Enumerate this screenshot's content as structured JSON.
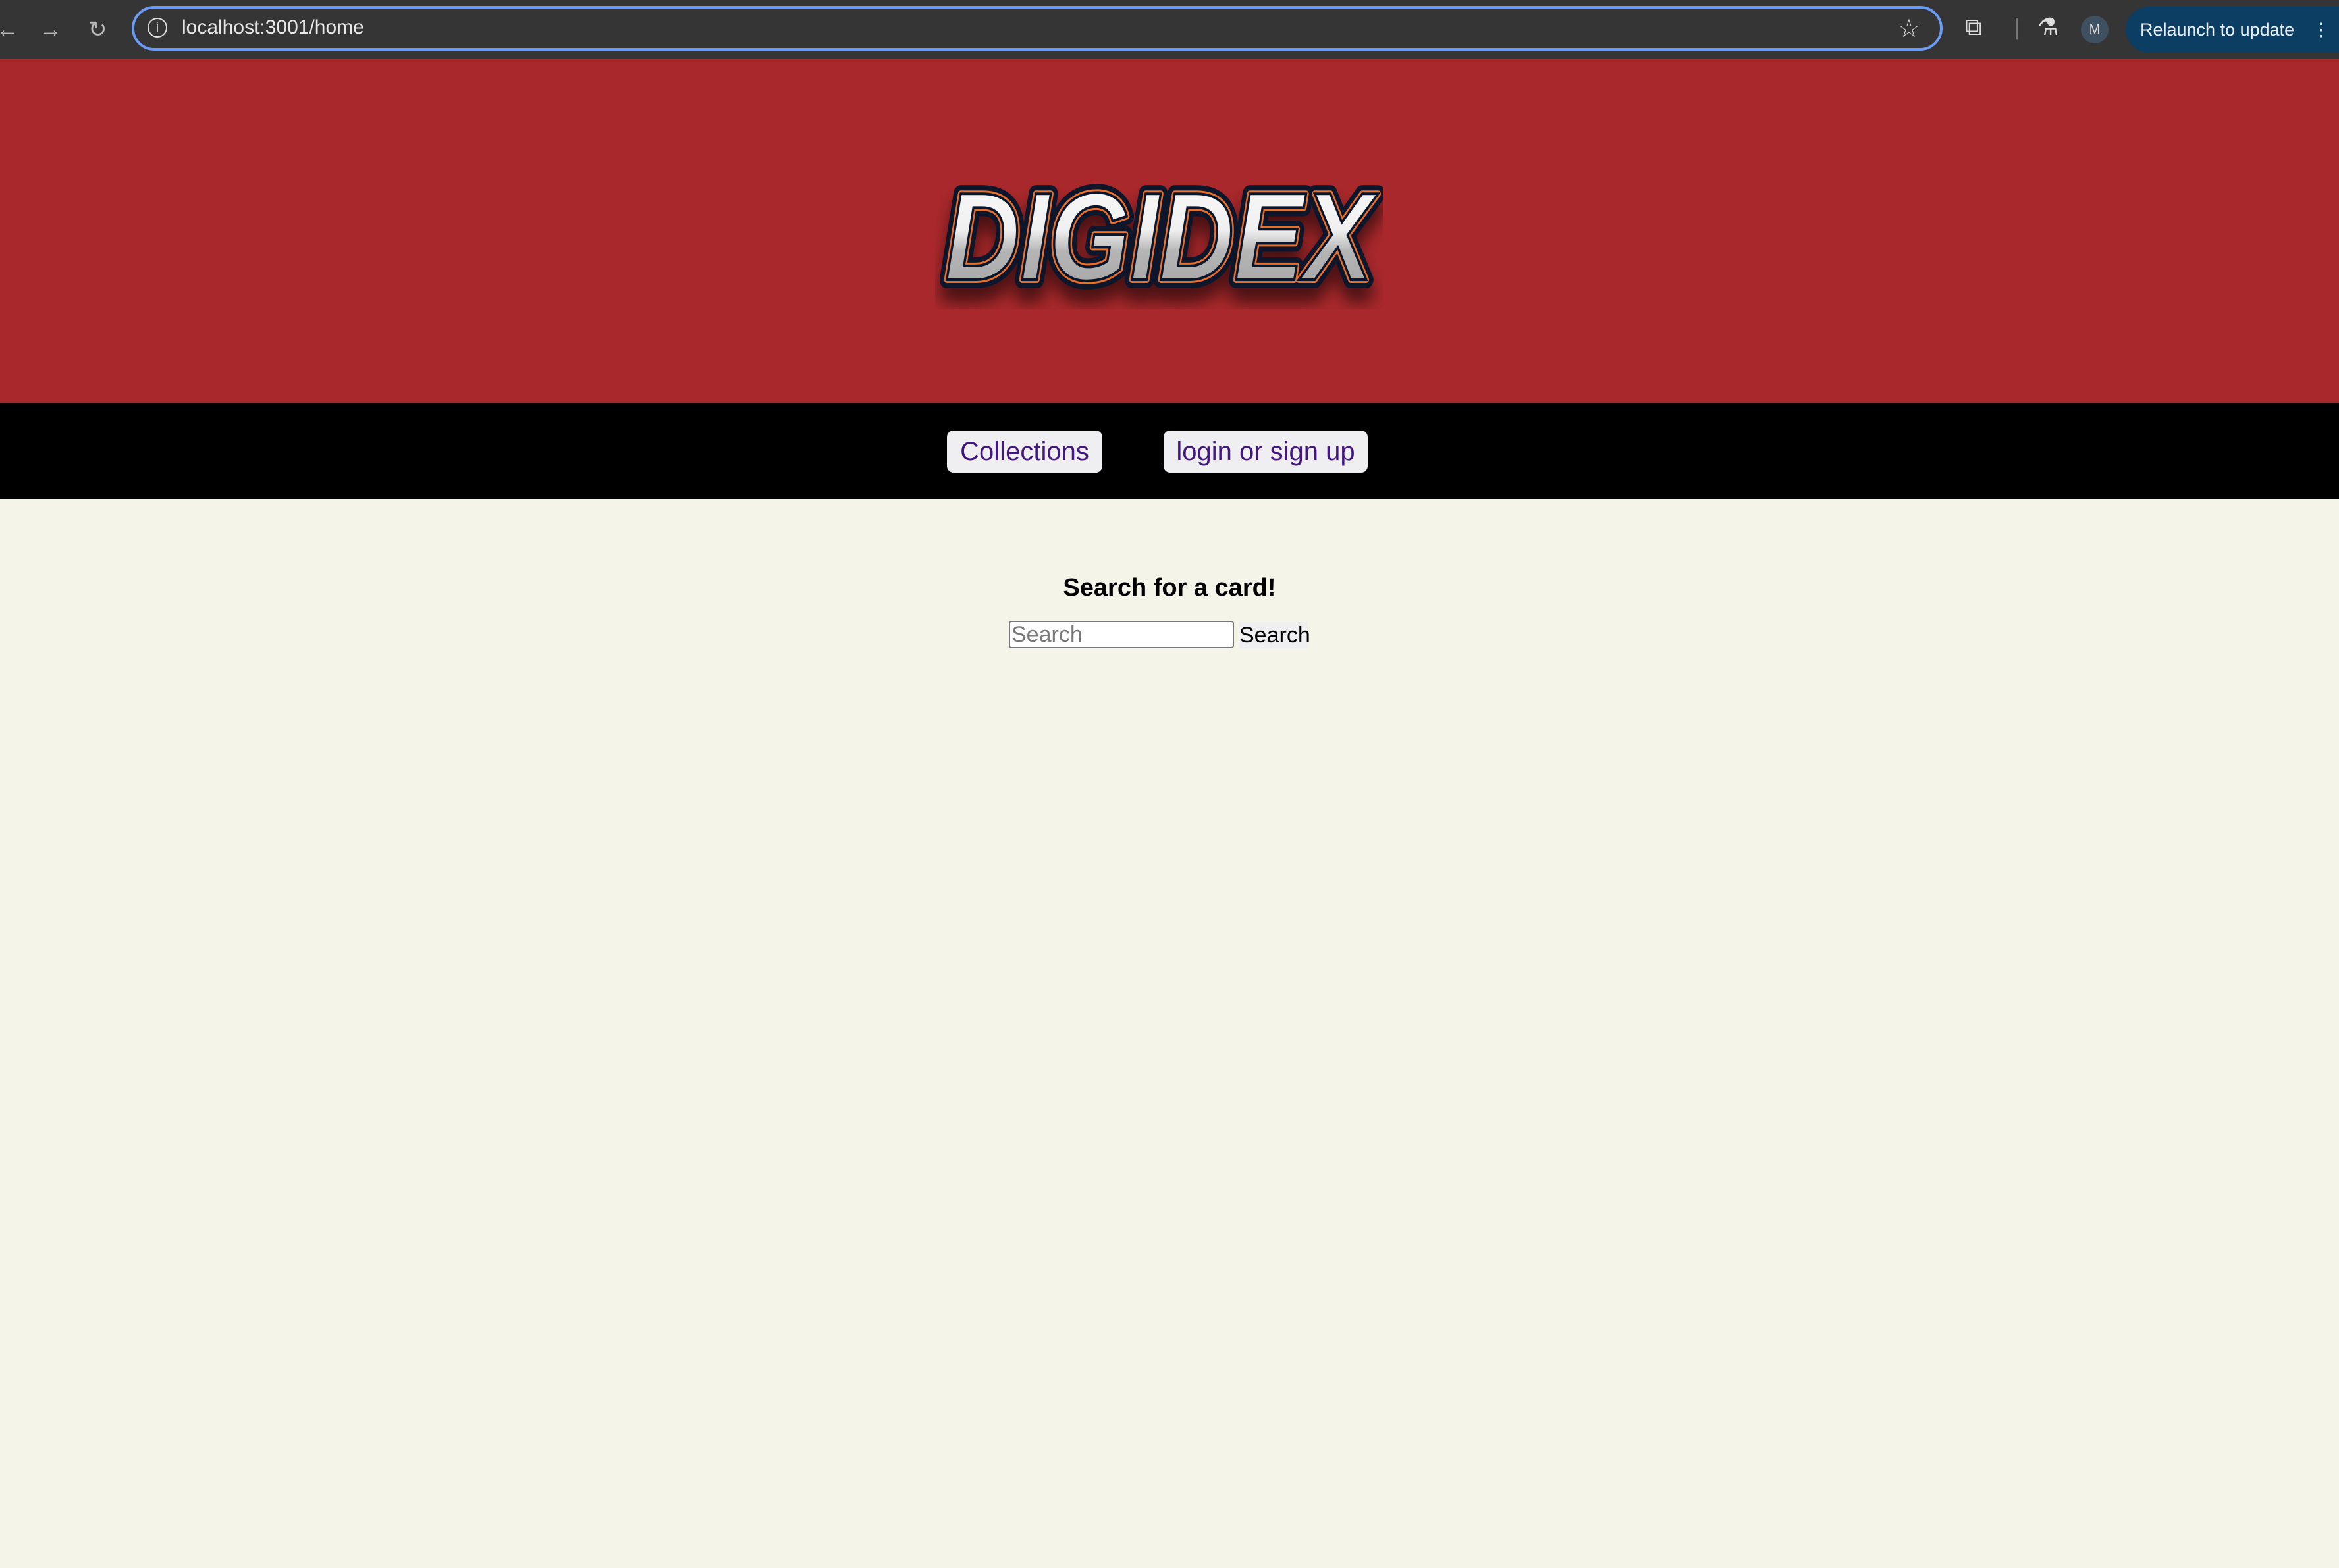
{
  "browser": {
    "url": "localhost:3001/home",
    "relaunch_label": "Relaunch to update",
    "profile_initial": "M"
  },
  "header": {
    "logo_text": "DIGIDEX",
    "brand_color": "#a9282b"
  },
  "nav": {
    "collections_label": "Collections",
    "login_label": "login or sign up"
  },
  "main": {
    "title": "Search for a card!",
    "search_placeholder": "Search",
    "search_value": "",
    "search_button_label": "Search"
  }
}
